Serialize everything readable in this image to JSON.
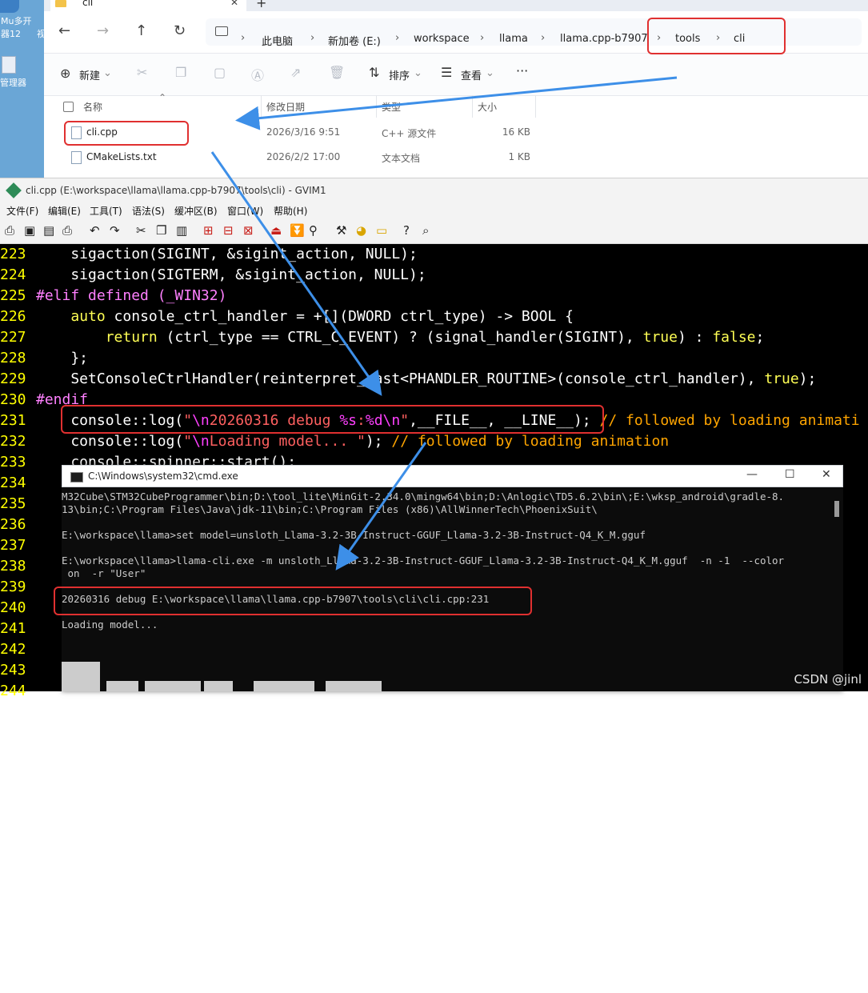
{
  "desktop": {
    "item1_label": "Mu多开",
    "item1_sub": "器12",
    "item1_side": "视",
    "item2_label": "管理器"
  },
  "explorer": {
    "tab_title": "cli",
    "tab_close": "✕",
    "new_tab": "+",
    "breadcrumbs": [
      "此电脑",
      "新加卷 (E:)",
      "workspace",
      "llama",
      "llama.cpp-b7907",
      "tools",
      "cli"
    ],
    "toolbar": {
      "new_label": "新建",
      "sort_label": "排序",
      "view_label": "查看",
      "more_label": "···"
    },
    "columns": {
      "name": "名称",
      "modified": "修改日期",
      "type": "类型",
      "size": "大小"
    },
    "files": [
      {
        "name": "cli.cpp",
        "modified": "2026/3/16 9:51",
        "type": "C++ 源文件",
        "size": "16 KB"
      },
      {
        "name": "CMakeLists.txt",
        "modified": "2026/2/2 17:00",
        "type": "文本文档",
        "size": "1 KB"
      }
    ]
  },
  "gvim": {
    "title": "cli.cpp (E:\\workspace\\llama\\llama.cpp-b7907\\tools\\cli) - GVIM1",
    "menu": [
      "文件(F)",
      "编辑(E)",
      "工具(T)",
      "语法(S)",
      "缓冲区(B)",
      "窗口(W)",
      "帮助(H)"
    ],
    "line_numbers": [
      "223",
      "224",
      "225",
      "226",
      "227",
      "228",
      "229",
      "230",
      "231",
      "232",
      "233",
      "234",
      "235",
      "236",
      "237",
      "238",
      "239",
      "240",
      "241",
      "242",
      "243",
      "244"
    ]
  },
  "cmd": {
    "title": "C:\\Windows\\system32\\cmd.exe",
    "lines": [
      "M32Cube\\STM32CubeProgrammer\\bin;D:\\tool_lite\\MinGit-2.34.0\\mingw64\\bin;D:\\Anlogic\\TD5.6.2\\bin\\;E:\\wksp_android\\gradle-8.",
      "13\\bin;C:\\Program Files\\Java\\jdk-11\\bin;C:\\Program Files (x86)\\AllWinnerTech\\PhoenixSuit\\",
      "",
      "E:\\workspace\\llama>set model=unsloth_Llama-3.2-3B-Instruct-GGUF_Llama-3.2-3B-Instruct-Q4_K_M.gguf",
      "",
      "E:\\workspace\\llama>llama-cli.exe -m unsloth_Llama-3.2-3B-Instruct-GGUF_Llama-3.2-3B-Instruct-Q4_K_M.gguf  -n -1  --color",
      " on  -r \"User\"",
      "",
      "20260316 debug E:\\workspace\\llama\\llama.cpp-b7907\\tools\\cli\\cli.cpp:231",
      "",
      "Loading model..."
    ]
  },
  "watermark": "CSDN @jinl"
}
